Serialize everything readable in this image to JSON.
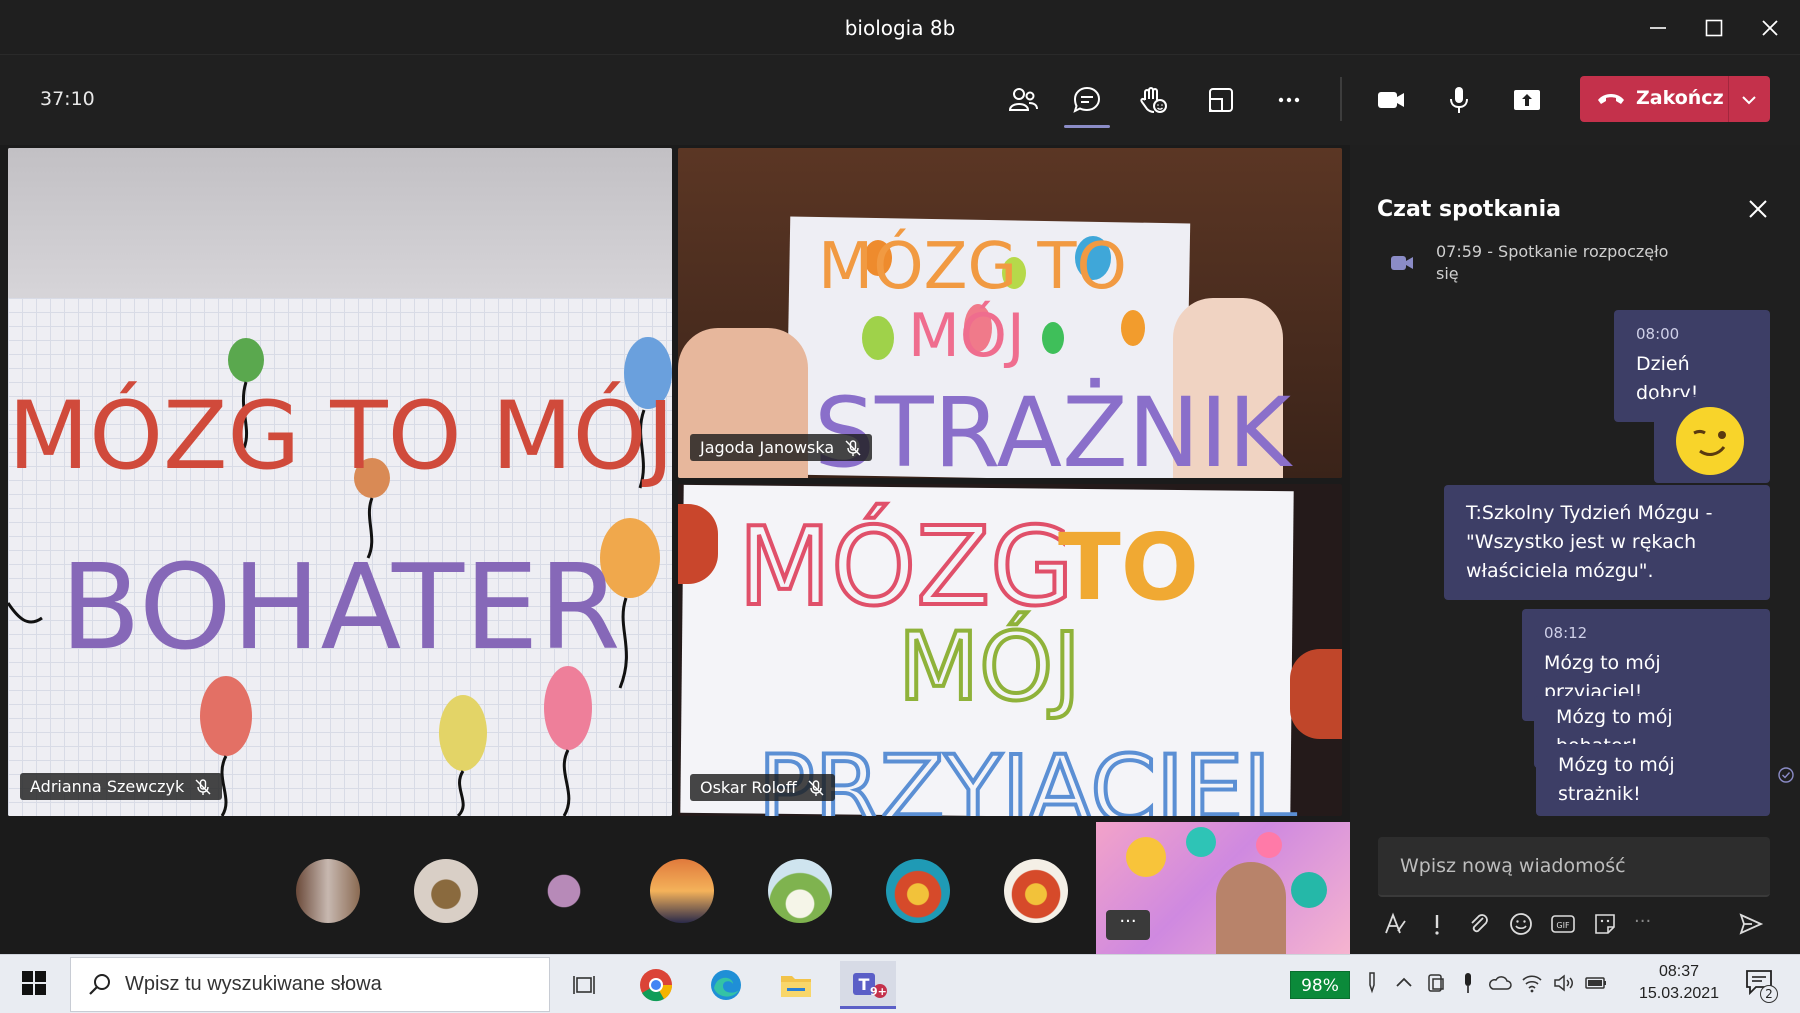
{
  "window": {
    "title": "biologia 8b"
  },
  "toolbar": {
    "timer": "37:10",
    "end_label": "Zakończ"
  },
  "tiles": {
    "top_left_name": "Adrianna Szewczyk",
    "top_right_name": "Jagoda Janowska",
    "bottom_right_name": "Oskar Roloff",
    "poster_left": {
      "line1": "MÓZG TO MÓJ",
      "line2": "BOHATER"
    },
    "poster_right_top": {
      "line1": "MÓZG TO",
      "line2": "MÓJ",
      "line3": "STRAŻNIK"
    },
    "poster_right_bottom": {
      "line1": "MÓZG",
      "line1b": "TO",
      "line2": "MÓJ",
      "line3": "PRZYJACIEL"
    }
  },
  "strip": {
    "more_label": "···"
  },
  "chat": {
    "title": "Czat spotkania",
    "system_message": "07:59 - Spotkanie rozpoczęło się",
    "messages": [
      {
        "time": "08:00",
        "text": "Dzień dobry!"
      },
      {
        "text": "T:Szkolny Tydzień Mózgu - \"Wszystko jest w rękach właściciela mózgu\"."
      },
      {
        "time": "08:12",
        "text": "Mózg to mój przyjaciel!"
      },
      {
        "text": "Mózg to mój bohater!"
      },
      {
        "text": "Mózg to mój strażnik!"
      }
    ],
    "compose_placeholder": "Wpisz nową wiadomość",
    "more_label": "···"
  },
  "taskbar": {
    "search_placeholder": "Wpisz tu wyszukiwane słowa",
    "battery": "98%",
    "time": "08:37",
    "date": "15.03.2021",
    "notifications": "2",
    "teams_badge": "9+"
  },
  "colors": {
    "end_button": "#c4314b",
    "chat_bubble": "#3d3e66",
    "accent": "#8b8cc7",
    "battery": "#0b8a3a"
  }
}
